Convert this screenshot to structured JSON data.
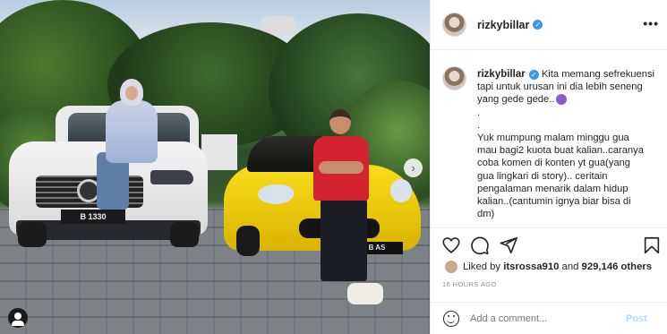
{
  "post": {
    "username": "rizkybillar",
    "caption_lines": [
      "Kita memang sefrekuensi",
      "tapi untuk urusan ini dia lebih seneng",
      "yang gede gede..",
      ".",
      ".",
      "Yuk mumpung malam minggu gua",
      "mau bagi2 kuota buat kalian..caranya",
      "coba komen di konten yt gua(yang",
      "gua lingkari di story).. ceritain",
      "pengalaman menarik dalam hidup",
      "kalian..(cantumin ignya biar bisa di",
      "dm)"
    ],
    "liked_by_prefix": "Liked by",
    "liked_by_user": "itsrossa910",
    "liked_by_and": "and",
    "liked_by_count": "929,146 others",
    "timestamp": "16 HOURS AGO",
    "comment_placeholder": "Add a comment...",
    "post_label": "Post"
  },
  "photo": {
    "suv_plate": "B 1330",
    "car_plate": "B  AS"
  },
  "icons": {
    "verified": "verified-badge-icon",
    "more": "more-icon",
    "like": "heart-icon",
    "comment": "comment-icon",
    "share": "share-icon",
    "save": "bookmark-icon",
    "emoji": "smile-icon",
    "next": "chevron-right-icon",
    "tags": "user-tag-icon"
  },
  "colors": {
    "accent": "#3897f0",
    "post_disabled": "#b3dbff",
    "muted": "#8e8e8e"
  }
}
